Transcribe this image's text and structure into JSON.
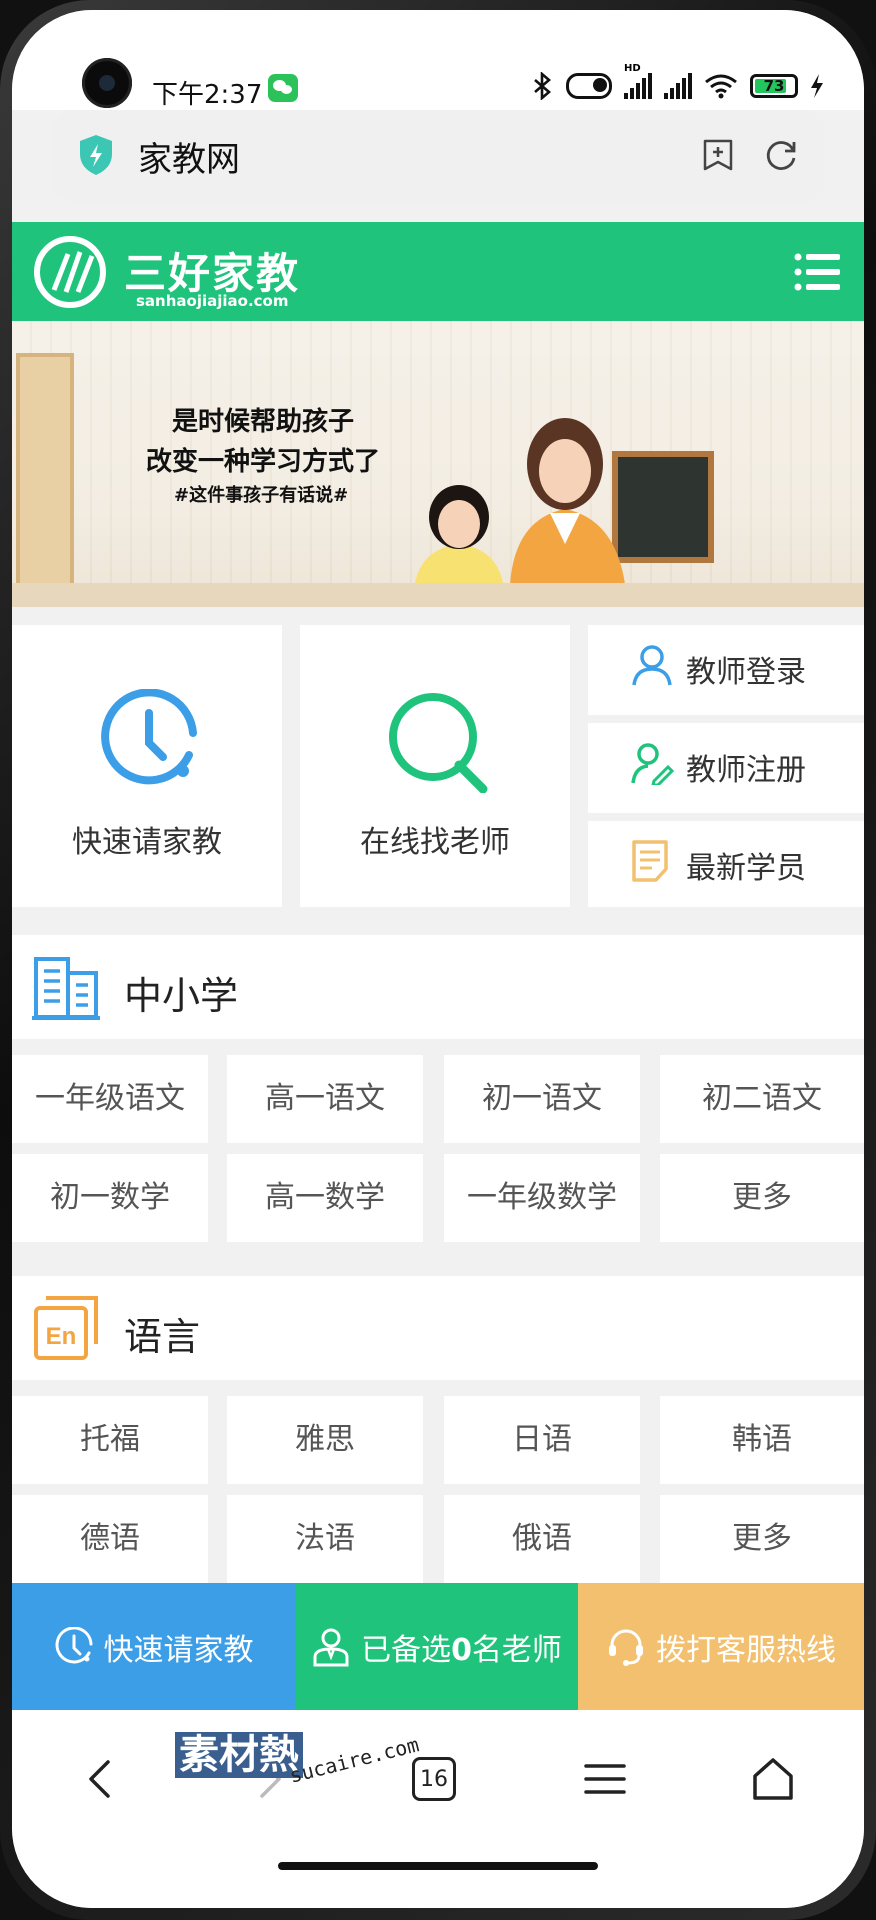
{
  "status_bar": {
    "time": "下午2:37",
    "battery": "73",
    "network_badge": "HD",
    "icons": [
      "wechat-icon",
      "bluetooth-icon",
      "toggle-icon",
      "signal-icon",
      "signal-icon",
      "wifi-icon",
      "battery-icon",
      "charging-icon"
    ]
  },
  "browser": {
    "url_title": "家教网",
    "tab_count": "16"
  },
  "site": {
    "brand_cn": "三好家教",
    "brand_en": "sanhaojiajiao.com"
  },
  "banner": {
    "line1": "是时候帮助孩子",
    "line2": "改变一种学习方式了",
    "line3": "#这件事孩子有话说#"
  },
  "quick": {
    "fast_request": "快速请家教",
    "find_teacher": "在线找老师",
    "teacher_login": "教师登录",
    "teacher_register": "教师注册",
    "latest_students": "最新学员"
  },
  "sections": [
    {
      "title": "中小学",
      "items": [
        "一年级语文",
        "高一语文",
        "初一语文",
        "初二语文",
        "初一数学",
        "高一数学",
        "一年级数学",
        "更多"
      ]
    },
    {
      "title": "语言",
      "items": [
        "托福",
        "雅思",
        "日语",
        "韩语",
        "德语",
        "法语",
        "俄语",
        "更多"
      ]
    }
  ],
  "bottom_bar": {
    "fast_request": "快速请家教",
    "selected_prefix": "已备选",
    "selected_count": "0",
    "selected_suffix": "名老师",
    "hotline": "拨打客服热线"
  },
  "watermark": {
    "text": "素材熱",
    "url": "sucaire.com"
  },
  "colors": {
    "brand_green": "#1fc37c",
    "blue": "#3d9ee8",
    "orange": "#f2c06f"
  }
}
